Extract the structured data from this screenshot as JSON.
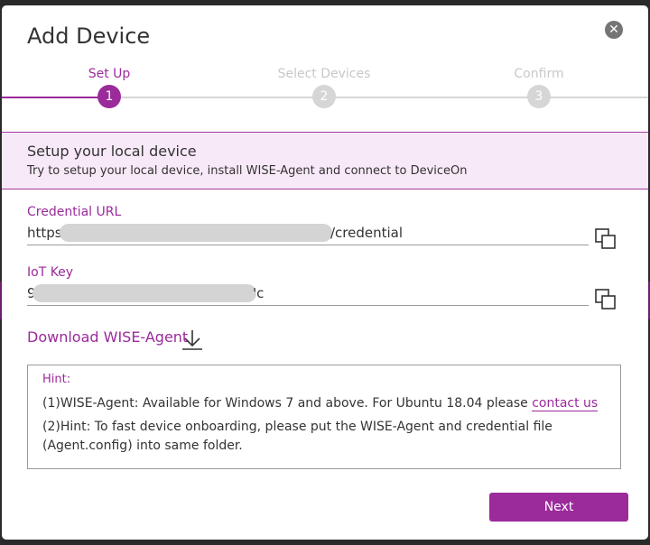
{
  "dialog": {
    "title": "Add Device",
    "close_icon": "close-icon"
  },
  "stepper": {
    "steps": [
      {
        "label": "Set Up",
        "number": "1",
        "state": "active"
      },
      {
        "label": "Select Devices",
        "number": "2",
        "state": "inactive"
      },
      {
        "label": "Confirm",
        "number": "3",
        "state": "inactive"
      }
    ]
  },
  "banner": {
    "title": "Setup your local device",
    "subtitle": "Try to setup your local device, install WISE-Agent and connect to DeviceOn"
  },
  "credential": {
    "label": "Credential URL",
    "value_prefix": "https",
    "value_suffix": "/credential",
    "copy_icon": "copy-icon"
  },
  "iot_key": {
    "label": "IoT Key",
    "value_prefix": "9",
    "value_suffix": "'c",
    "copy_icon": "copy-icon"
  },
  "download": {
    "label": "Download WISE-Agent",
    "icon": "download-icon"
  },
  "hint": {
    "title": "Hint:",
    "line1_text": "(1)WISE-Agent: Available for Windows 7 and above. For Ubuntu 18.04 please ",
    "line1_link": "contact us",
    "line2": "(2)Hint: To fast device onboarding, please put the WISE-Agent and credential file (Agent.config) into same folder."
  },
  "footer": {
    "next_label": "Next"
  },
  "colors": {
    "accent": "#9b2a9b",
    "banner_bg": "#f8e9f8",
    "inactive_step": "#d6d6d6"
  }
}
